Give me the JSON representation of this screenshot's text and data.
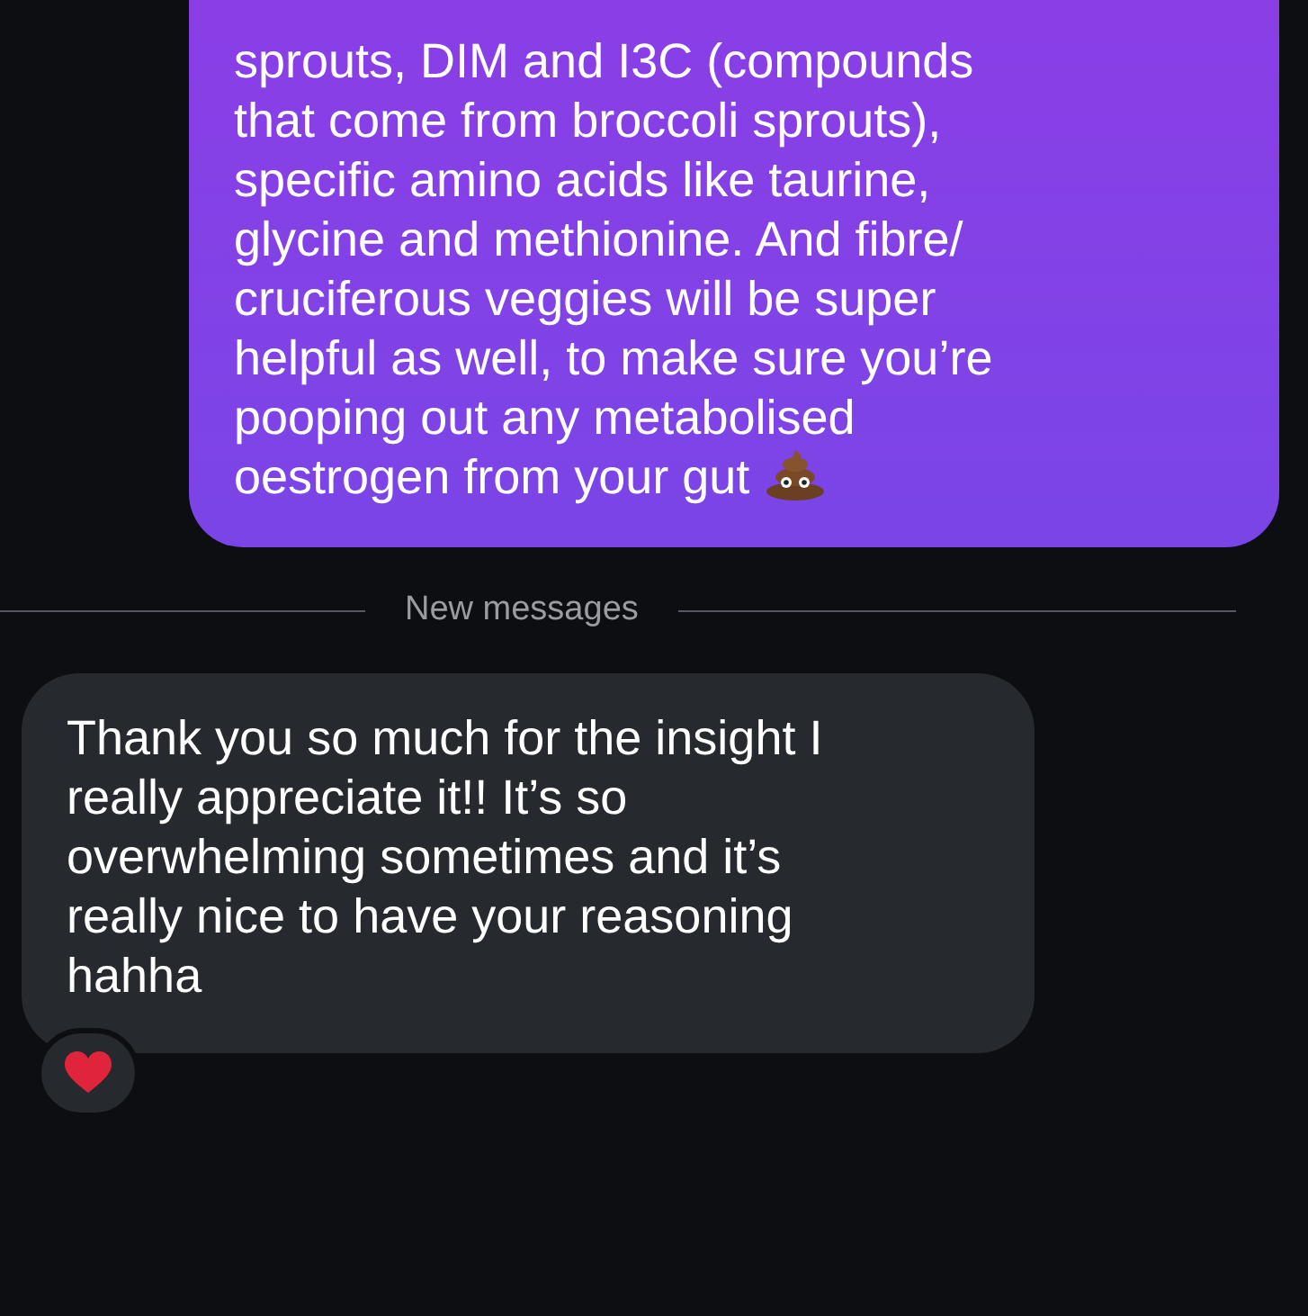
{
  "messages": [
    {
      "kind": "outgoing",
      "text": "sprouts, DIM and I3C (compounds\nthat come from broccoli sprouts),\nspecific amino acids like taurine,\nglycine and methionine. And fibre/\ncruciferous veggies will be super\nhelpful as well, to make sure you’re\npooping out any metabolised\noestrogen from your gut",
      "ends_with_emoji": true
    },
    {
      "kind": "divider",
      "text": "New messages"
    },
    {
      "kind": "incoming",
      "text": "Thank you so much for the insight I\nreally appreciate it!! It’s so\noverwhelming sometimes and it’s\nreally nice to have your reasoning\nhahha",
      "reacted": true
    }
  ]
}
